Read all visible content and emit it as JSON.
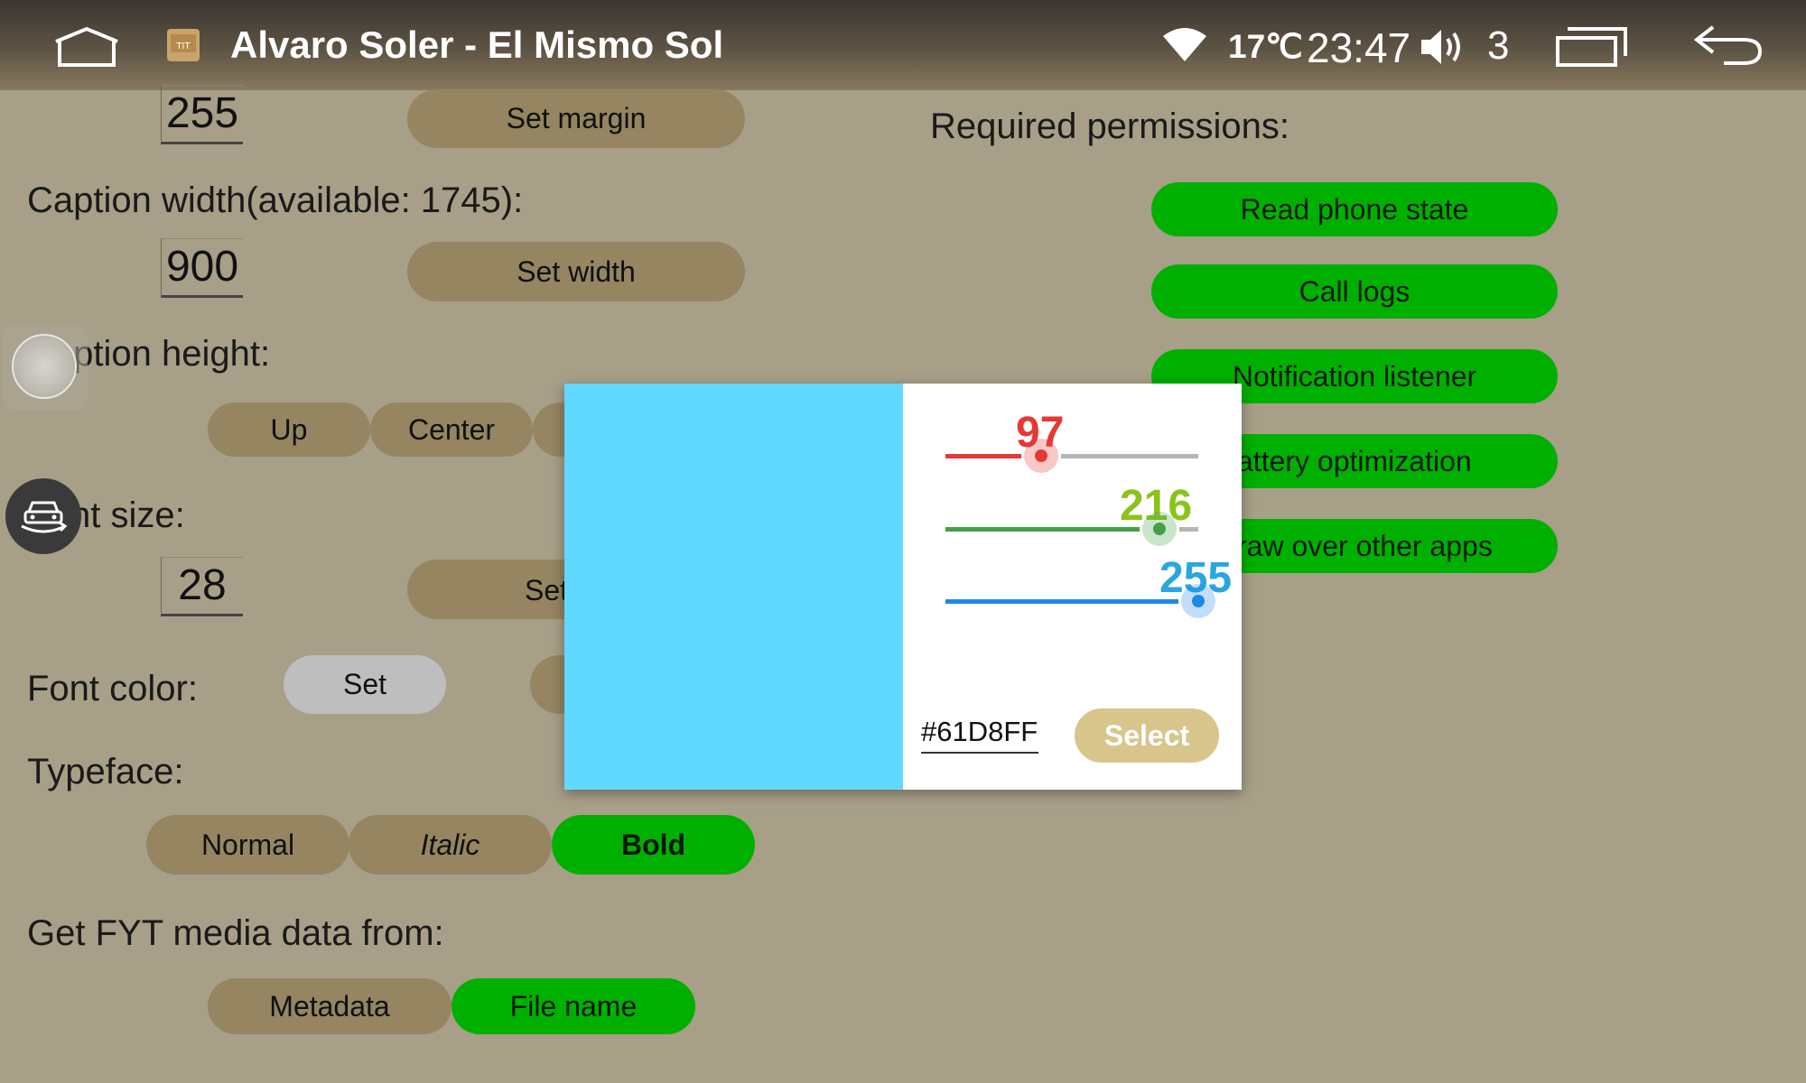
{
  "status_bar": {
    "app_title": "Alvaro Soler - El Mismo Sol",
    "temperature": "17℃",
    "time": "23:47",
    "volume_level": "3",
    "icons": [
      "home-icon",
      "music-app-icon",
      "wifi-icon",
      "volume-icon",
      "recent-apps-icon",
      "back-icon"
    ]
  },
  "settings": {
    "margin_value": "255",
    "set_margin_label": "Set margin",
    "caption_width_label": "Caption width(available: 1745):",
    "width_value": "900",
    "set_width_label": "Set width",
    "caption_height_label": "Caption height:",
    "height_options": [
      "Up",
      "Center"
    ],
    "font_size_label": "nt size:",
    "font_size_value": "28",
    "set_font_size_label": "Set",
    "font_color_label": "Font color:",
    "font_color_set_label": "Set",
    "typeface_label": "Typeface:",
    "typeface_options": [
      "Normal",
      "Italic",
      "Bold"
    ],
    "typeface_selected": "Bold",
    "media_source_label": "Get FYT media data from:",
    "media_source_options": [
      "Metadata",
      "File name"
    ],
    "media_source_selected": "File name"
  },
  "permissions": {
    "title": "Required permissions:",
    "buttons": [
      "Read phone state",
      "Call logs",
      "Notification listener",
      "attery optimization",
      "raw over other apps"
    ]
  },
  "color_dialog": {
    "preview_color": "#61D8FF",
    "red_value": "97",
    "green_value": "216",
    "blue_value": "255",
    "red_fraction": 0.38,
    "green_fraction": 0.847,
    "blue_fraction": 1.0,
    "hex_value": "#61D8FF",
    "select_label": "Select"
  },
  "colors": {
    "background": "#a89f88",
    "button": "#958560",
    "active_green": "#00b000",
    "red_slider": "#e53935",
    "green_slider": "#43a047",
    "green_value": "#8cc21a",
    "blue_slider": "#1e88e5",
    "blue_value": "#29a6e0"
  }
}
